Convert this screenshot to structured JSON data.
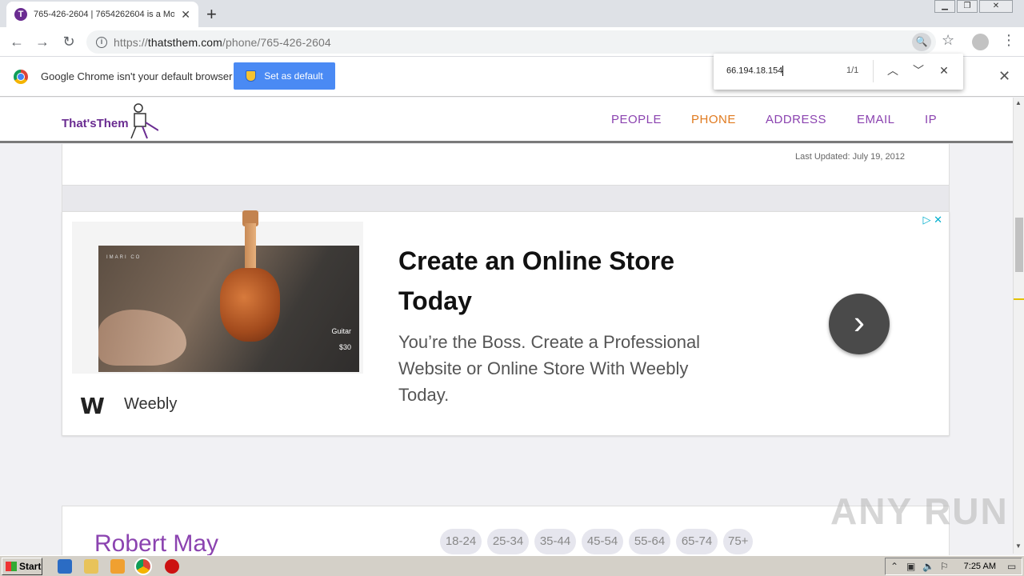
{
  "browser": {
    "tab_title": "765-426-2604 | 7654262604 is a Mo",
    "tab_favicon_letter": "T",
    "url_scheme": "https://",
    "url_host": "thatsthem.com",
    "url_path": "/phone/765-426-2604"
  },
  "infobar": {
    "message": "Google Chrome isn't your default browser",
    "button_label": "Set as default"
  },
  "findbar": {
    "query": "66.194.18.154",
    "count": "1/1"
  },
  "site": {
    "logo": "That'sThem",
    "nav": [
      "PEOPLE",
      "PHONE",
      "ADDRESS",
      "EMAIL",
      "IP"
    ],
    "active_nav": "PHONE"
  },
  "record": {
    "last_updated": "Last Updated: July 19, 2012"
  },
  "ad": {
    "title": "Create an Online Store Today",
    "description": "You’re the Boss. Create a Professional Website or Online Store With Weebly Today.",
    "advertiser": "Weebly",
    "image_brand": "IMARI CO",
    "image_item": "Guitar",
    "image_price": "$30"
  },
  "person": {
    "name": "Robert May",
    "age_ranges": [
      "18-24",
      "25-34",
      "35-44",
      "45-54",
      "55-64",
      "65-74",
      "75+"
    ]
  },
  "watermark": "ANY RUN",
  "taskbar": {
    "start_label": "Start",
    "clock": "7:25 AM"
  },
  "colors": {
    "brand_purple": "#8b43b0",
    "active_orange": "#e07a1f",
    "chrome_blue": "#4a8af4"
  }
}
